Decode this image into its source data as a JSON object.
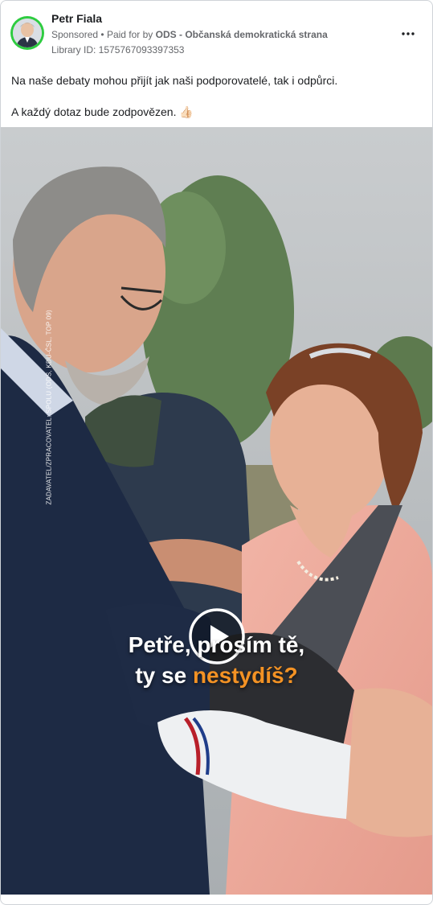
{
  "post": {
    "advertiser": "Petr Fiala",
    "sponsored": "Sponsored",
    "paid_for_prefix": "Paid for by",
    "paid_for_by": "ODS - Občanská demokratická strana",
    "library_id": "Library ID: 1575767093397353",
    "text_line1": "Na naše debaty mohou přijít jak naši podporovatelé, tak i odpůrci.",
    "text_line2": "A každý dotaz bude zodpovězen. 👍🏻"
  },
  "video": {
    "caption_line1": "Petře, prosím tě,",
    "caption_line2_part1": "ty se ",
    "caption_line2_highlight": "nestydíš?",
    "side_credit": "ZADAVATEL/ZPRACOVATEL: SPOLU (ODS, KDU-ČSL, TOP 09)",
    "highlight_color": "#f39224"
  },
  "icons": {
    "more": "more-horizontal-icon",
    "play": "play-icon"
  }
}
